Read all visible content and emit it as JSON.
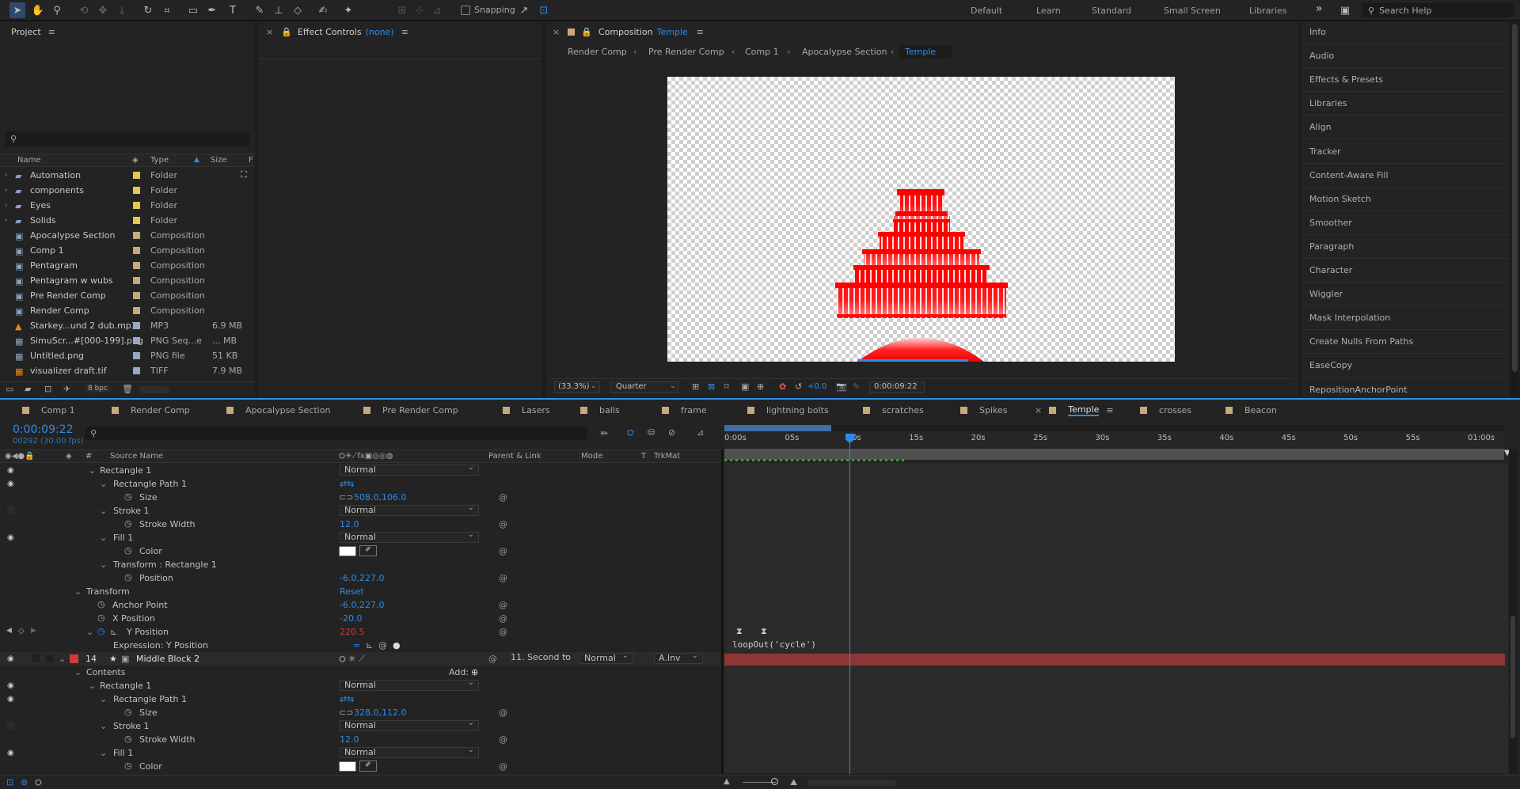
{
  "toolbar": {
    "snapping_label": "Snapping",
    "search_placeholder": "Search Help"
  },
  "workspaces": [
    "Default",
    "Learn",
    "Standard",
    "Small Screen",
    "Libraries"
  ],
  "project": {
    "title": "Project",
    "bpc": "8 bpc",
    "columns": {
      "name": "Name",
      "type": "Type",
      "size": "Size",
      "extra": "F"
    },
    "items": [
      {
        "name": "Automation",
        "type": "Folder",
        "size": "",
        "icon": "folder-icon",
        "label_color": "#e6c84b"
      },
      {
        "name": "components",
        "type": "Folder",
        "size": "",
        "icon": "folder-icon",
        "label_color": "#e6c84b"
      },
      {
        "name": "Eyes",
        "type": "Folder",
        "size": "",
        "icon": "folder-icon",
        "label_color": "#e6c84b"
      },
      {
        "name": "Solids",
        "type": "Folder",
        "size": "",
        "icon": "folder-icon",
        "label_color": "#e6c84b"
      },
      {
        "name": "Apocalypse Section",
        "type": "Composition",
        "size": "",
        "icon": "composition-icon",
        "label_color": "#c8a97a"
      },
      {
        "name": "Comp 1",
        "type": "Composition",
        "size": "",
        "icon": "composition-icon",
        "label_color": "#c8a97a"
      },
      {
        "name": "Pentagram",
        "type": "Composition",
        "size": "",
        "icon": "composition-icon",
        "label_color": "#c8a97a"
      },
      {
        "name": "Pentagram w wubs",
        "type": "Composition",
        "size": "",
        "icon": "composition-icon",
        "label_color": "#c8a97a"
      },
      {
        "name": "Pre Render Comp",
        "type": "Composition",
        "size": "",
        "icon": "composition-icon",
        "label_color": "#c8a97a"
      },
      {
        "name": "Render Comp",
        "type": "Composition",
        "size": "",
        "icon": "composition-icon",
        "label_color": "#c8a97a"
      },
      {
        "name": "Starkey...und 2 dub.mp3",
        "type": "MP3",
        "size": "6.9 MB",
        "icon": "audio-file-icon",
        "label_color": "#9aa8c8"
      },
      {
        "name": "SimuScr...#[000-199].png",
        "type": "PNG Seq...e",
        "size": "... MB",
        "icon": "image-sequence-icon",
        "label_color": "#9aa8c8"
      },
      {
        "name": "Untitled.png",
        "type": "PNG file",
        "size": "51 KB",
        "icon": "image-file-icon",
        "label_color": "#9aa8c8"
      },
      {
        "name": "visualizer draft.tif",
        "type": "TIFF",
        "size": "7.9 MB",
        "icon": "tiff-file-icon",
        "label_color": "#9aa8c8"
      }
    ]
  },
  "effect_controls": {
    "title": "Effect Controls",
    "target": "(none)"
  },
  "composition": {
    "title": "Composition",
    "name": "Temple",
    "breadcrumbs": [
      "Render Comp",
      "Pre Render Comp",
      "Comp 1",
      "Apocalypse Section",
      "Temple"
    ],
    "zoom": "(33.3%)",
    "resolution": "Quarter",
    "exposure": "+0.0",
    "timecode": "0:00:09:22"
  },
  "right_panel": [
    "Info",
    "Audio",
    "Effects & Presets",
    "Libraries",
    "Align",
    "Tracker",
    "Content-Aware Fill",
    "Motion Sketch",
    "Smoother",
    "Paragraph",
    "Character",
    "Wiggler",
    "Mask Interpolation",
    "Create Nulls From Paths",
    "EaseCopy",
    "RepositionAnchorPoint"
  ],
  "timeline": {
    "tabs": [
      {
        "label": "Comp 1",
        "color": "#c8a97a"
      },
      {
        "label": "Render Comp",
        "color": "#c8a97a"
      },
      {
        "label": "Apocalypse Section",
        "color": "#c8a97a"
      },
      {
        "label": "Pre Render Comp",
        "color": "#c8a97a"
      },
      {
        "label": "Lasers",
        "color": "#c8a97a"
      },
      {
        "label": "balls",
        "color": "#c8a97a"
      },
      {
        "label": "frame",
        "color": "#c8a97a"
      },
      {
        "label": "lightning bolts",
        "color": "#c8a97a"
      },
      {
        "label": "scratches",
        "color": "#c8a97a"
      },
      {
        "label": "Spikes",
        "color": "#c8a97a"
      },
      {
        "label": "Temple",
        "color": "#c8a97a"
      },
      {
        "label": "crosses",
        "color": "#c8a97a"
      },
      {
        "label": "Beacon",
        "color": "#c8a97a"
      }
    ],
    "current_time": "0:00:09:22",
    "frame_info": "00292 (30.00 fps)",
    "columns": {
      "source_name": "Source Name",
      "parent": "Parent & Link",
      "mode": "Mode",
      "t": "T",
      "trkmat": "TrkMat"
    },
    "ruler": [
      "0:00s",
      "05s",
      "10s",
      "15s",
      "20s",
      "25s",
      "30s",
      "35s",
      "40s",
      "45s",
      "50s",
      "55s",
      "01:00s"
    ],
    "playhead_seconds": 9.73,
    "duration_seconds": 60,
    "expression_text": "loopOut('cycle')",
    "layers": {
      "rect1_name": "Rectangle 1",
      "rect1_mode": "Normal",
      "path1_name": "Rectangle Path 1",
      "size_label": "Size",
      "size_value": "508.0,106.0",
      "stroke_name": "Stroke 1",
      "stroke_mode": "Normal",
      "stroke_width_label": "Stroke Width",
      "stroke_width_value": "12.0",
      "fill_name": "Fill 1",
      "fill_mode": "Normal",
      "color_label": "Color",
      "transform_rect_name": "Transform : Rectangle 1",
      "position_label": "Position",
      "position_value": "-6.0,227.0",
      "transform_name": "Transform",
      "reset_label": "Reset",
      "anchor_label": "Anchor Point",
      "anchor_value": "-6.0,227.0",
      "xpos_label": "X Position",
      "xpos_value": "-20.0",
      "ypos_label": "Y Position",
      "ypos_value": "220.5",
      "expression_label": "Expression: Y Position",
      "layer14_number": "14",
      "layer14_name": "Middle Block 2",
      "layer14_parent": "11. Second to",
      "layer14_mode": "Normal",
      "layer14_trkmat": "A.Inv",
      "contents_label": "Contents",
      "add_label": "Add:",
      "b_rect1_name": "Rectangle 1",
      "b_rect1_mode": "Normal",
      "b_path1_name": "Rectangle Path 1",
      "b_size_label": "Size",
      "b_size_value": "328.0,112.0",
      "b_stroke_name": "Stroke 1",
      "b_stroke_mode": "Normal",
      "b_stroke_width_label": "Stroke Width",
      "b_stroke_width_value": "12.0",
      "b_fill_name": "Fill 1",
      "b_fill_mode": "Normal",
      "b_color_label": "Color"
    }
  }
}
